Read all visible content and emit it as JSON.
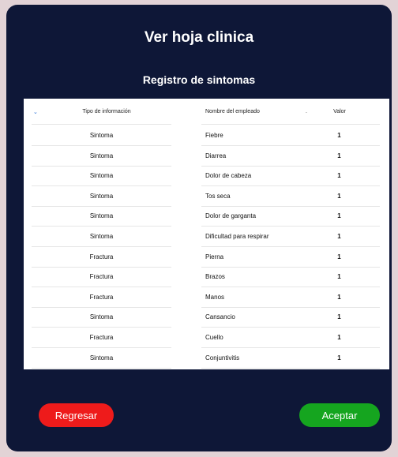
{
  "dialog": {
    "title": "Ver hoja clinica",
    "subtitle": "Registro de sintomas"
  },
  "table": {
    "headers": {
      "tipo": "Tipo de información",
      "nombre": "Nombre del empleado",
      "valor": "Valor"
    },
    "rows": [
      {
        "tipo": "Sintoma",
        "nombre": "Fiebre",
        "valor": "1"
      },
      {
        "tipo": "Sintoma",
        "nombre": "Diarrea",
        "valor": "1"
      },
      {
        "tipo": "Sintoma",
        "nombre": "Dolor de cabeza",
        "valor": "1"
      },
      {
        "tipo": "Sintoma",
        "nombre": "Tos seca",
        "valor": "1"
      },
      {
        "tipo": "Sintoma",
        "nombre": "Dolor de garganta",
        "valor": "1"
      },
      {
        "tipo": "Sintoma",
        "nombre": "Dificultad para respirar",
        "valor": "1"
      },
      {
        "tipo": "Fractura",
        "nombre": "Pierna",
        "valor": "1"
      },
      {
        "tipo": "Fractura",
        "nombre": "Brazos",
        "valor": "1"
      },
      {
        "tipo": "Fractura",
        "nombre": "Manos",
        "valor": "1"
      },
      {
        "tipo": "Sintoma",
        "nombre": "Cansancio",
        "valor": "1"
      },
      {
        "tipo": "Fractura",
        "nombre": "Cuello",
        "valor": "1"
      },
      {
        "tipo": "Sintoma",
        "nombre": "Conjuntivitis",
        "valor": "1"
      }
    ]
  },
  "buttons": {
    "back_label": "Regresar",
    "ok_label": "Aceptar"
  },
  "colors": {
    "background": "#e2d3d6",
    "dialog": "#0e1737",
    "back_button": "#ee1b1b",
    "ok_button": "#15a51f"
  },
  "icons": {
    "sort": "sort-icon"
  }
}
